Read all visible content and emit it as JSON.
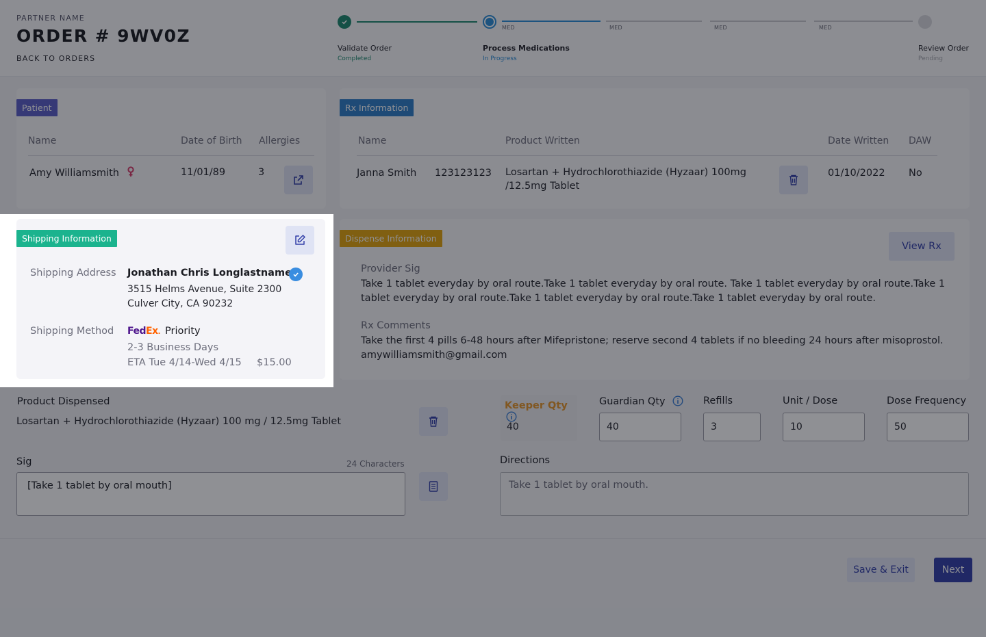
{
  "header": {
    "partner_name": "PARTNER NAME",
    "order_title": "ORDER # 9WV0Z",
    "back_link": "BACK TO ORDERS"
  },
  "stepper": {
    "steps": [
      {
        "title": "Validate Order",
        "status": "Completed"
      },
      {
        "title": "Process Medications",
        "status": "In Progress"
      },
      {
        "title": "Review Order",
        "status": "Pending"
      }
    ],
    "med_labels": [
      "MED",
      "MED",
      "MED",
      "MED"
    ],
    "colors": {
      "completed": "#1f8a70",
      "in_progress": "#2d8ed8",
      "pending": "#c9cad0"
    }
  },
  "patient": {
    "tag": "Patient",
    "headers": {
      "name": "Name",
      "dob": "Date of Birth",
      "allergies": "Allergies"
    },
    "name": "Amy Williamsmith",
    "dob": "11/01/89",
    "allergies": "3"
  },
  "rx_info": {
    "tag": "Rx Information",
    "headers": {
      "name": "Name",
      "product": "Product Written",
      "date": "Date Written",
      "daw": "DAW"
    },
    "name": "Janna Smith",
    "number": "123123123",
    "product": "Losartan + Hydrochlorothiazide (Hyzaar) 100mg /12.5mg Tablet",
    "date": "01/10/2022",
    "daw": "No"
  },
  "shipping": {
    "tag": "Shipping Information",
    "address_label": "Shipping Address",
    "recipient": "Jonathan Chris Longlastname",
    "address_line1": "3515 Helms Avenue, Suite 2300",
    "address_line2": "Culver City, CA 90232",
    "method_label": "Shipping Method",
    "carrier_logo_fed": "Fed",
    "carrier_logo_ex": "Ex",
    "service": "Priority",
    "days": "2-3 Business Days",
    "eta": "ETA Tue 4/14-Wed 4/15",
    "price": "$15.00"
  },
  "dispense": {
    "tag": "Dispense Information",
    "view_rx": "View Rx",
    "provider_sig_label": "Provider Sig",
    "provider_sig": "Take 1 tablet everyday by oral route.Take 1 tablet everyday by oral route. Take 1 tablet everyday by oral route.Take 1 tablet everyday by oral route.Take 1 tablet everyday by oral route.Take 1 tablet everyday by oral route.",
    "rx_comments_label": "Rx Comments",
    "rx_comments": "Take the first 4 pills 6-48 hours after Mifepristone; reserve second 4 tablets if no bleeding 24 hours after misoprostol.",
    "email": "amywilliamsmith@gmail.com"
  },
  "product": {
    "label": "Product Dispensed",
    "value": "Losartan + Hydrochlorothiazide (Hyzaar) 100 mg / 12.5mg Tablet"
  },
  "quantities": {
    "keeper_label": "Keeper Qty",
    "keeper_value": "40",
    "guardian_label": "Guardian Qty",
    "guardian_value": "40",
    "refills_label": "Refills",
    "refills_value": "3",
    "unit_label": "Unit / Dose",
    "unit_value": "10",
    "freq_label": "Dose Frequency",
    "freq_value": "50"
  },
  "sig": {
    "label": "Sig",
    "count": "24 Characters",
    "value": "[Take 1 tablet by oral mouth]"
  },
  "directions": {
    "label": "Directions",
    "placeholder": "Take 1 tablet by oral mouth."
  },
  "footer": {
    "save_exit": "Save & Exit",
    "next": "Next"
  },
  "colors": {
    "patient_tag": "#5b5ec8",
    "rx_tag": "#2f7fc8",
    "shipping_tag": "#1bb38e",
    "dispense_tag": "#e3a40e",
    "primary": "#3340a8",
    "keeper": "#e5962b"
  }
}
